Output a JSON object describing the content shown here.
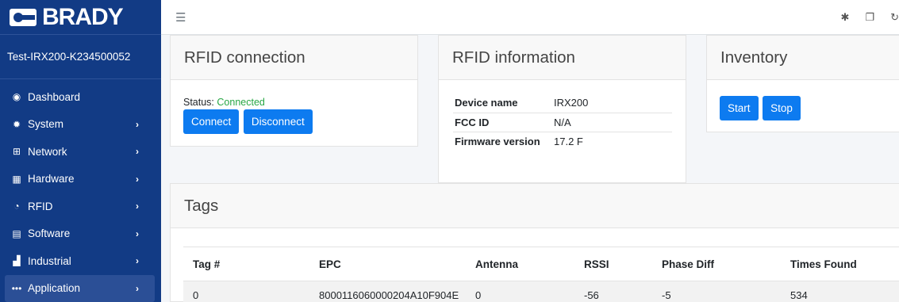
{
  "brand": {
    "name": "BRADY"
  },
  "sidebar": {
    "device_name": "Test-IRX200-K234500052",
    "items": [
      {
        "label": "Dashboard",
        "icon": "dashboard-icon",
        "chevron": false,
        "active": false
      },
      {
        "label": "System",
        "icon": "gear-icon",
        "chevron": true,
        "active": false
      },
      {
        "label": "Network",
        "icon": "network-icon",
        "chevron": true,
        "active": false
      },
      {
        "label": "Hardware",
        "icon": "chip-icon",
        "chevron": true,
        "active": false
      },
      {
        "label": "RFID",
        "icon": "rfid-icon",
        "chevron": true,
        "active": false
      },
      {
        "label": "Software",
        "icon": "grid-icon",
        "chevron": true,
        "active": false
      },
      {
        "label": "Industrial",
        "icon": "industry-icon",
        "chevron": true,
        "active": false
      },
      {
        "label": "Application",
        "icon": "dots-icon",
        "chevron": true,
        "active": true
      }
    ],
    "chevron_glyph": "›"
  },
  "connection": {
    "title": "RFID connection",
    "status_label": "Status:",
    "status_value": "Connected",
    "connect_label": "Connect",
    "disconnect_label": "Disconnect"
  },
  "info": {
    "title": "RFID information",
    "rows": [
      {
        "key": "Device name",
        "value": "IRX200"
      },
      {
        "key": "FCC ID",
        "value": "N/A"
      },
      {
        "key": "Firmware version",
        "value": "17.2 F"
      }
    ]
  },
  "inventory": {
    "title": "Inventory",
    "start_label": "Start",
    "stop_label": "Stop"
  },
  "tags": {
    "title": "Tags",
    "columns": [
      "Tag #",
      "EPC",
      "Antenna",
      "RSSI",
      "Phase Diff",
      "Times Found"
    ],
    "rows": [
      [
        "0",
        "8000116060000204A10F904E",
        "0",
        "-56",
        "-5",
        "534"
      ]
    ]
  },
  "colors": {
    "sidebar_bg": "#123b85",
    "primary_button": "#0d7bf0",
    "status_connected": "#28a745"
  }
}
